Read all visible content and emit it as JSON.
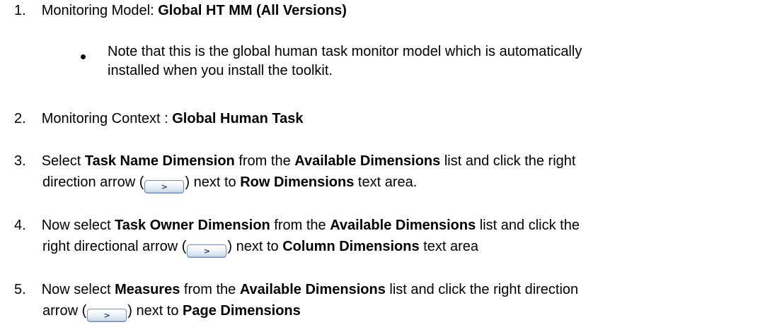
{
  "items": [
    {
      "num": "1.",
      "parts": [
        "Monitoring Model: ",
        "Global HT MM (All Versions)"
      ]
    },
    {
      "num": "2.",
      "parts": [
        "Monitoring Context : ",
        "Global Human Task"
      ]
    },
    {
      "num": "3.",
      "line1": [
        "Select ",
        "Task Name Dimension",
        " from the ",
        "Available Dimensions",
        " list and click the right"
      ],
      "line2_pre": "direction arrow (",
      "line2_post": [
        ") next to ",
        "Row Dimensions",
        " text area."
      ]
    },
    {
      "num": "4.",
      "line1": [
        "Now select ",
        "Task Owner Dimension",
        " from the ",
        "Available Dimensions",
        " list and click the"
      ],
      "line2_pre": "right directional arrow (",
      "line2_post": [
        ") next to ",
        "Column Dimensions",
        " text area"
      ]
    },
    {
      "num": "5.",
      "line1": [
        "Now select ",
        "Measures",
        " from the ",
        "Available Dimensions",
        " list and click the right direction"
      ],
      "line2_pre": "arrow (",
      "line2_post": [
        ") next to ",
        "Page Dimensions"
      ]
    }
  ],
  "note": {
    "line1": "Note that this is the global human task monitor model which is automatically",
    "line2": "installed when you install the toolkit."
  },
  "arrow_button_label": ">"
}
